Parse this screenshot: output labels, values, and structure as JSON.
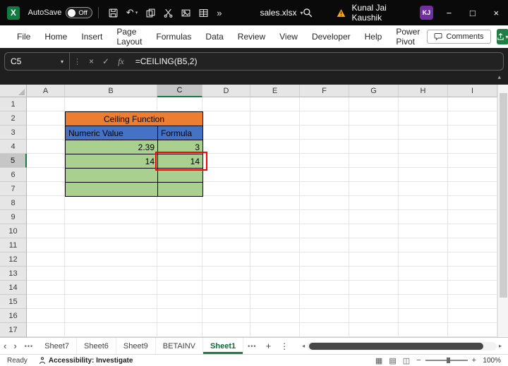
{
  "titlebar": {
    "logo_letter": "X",
    "autosave_label": "AutoSave",
    "autosave_state": "Off",
    "filename": "sales.xlsx",
    "user_name": "Kunal Jai Kaushik",
    "user_initials": "KJ"
  },
  "ribbon": {
    "tabs": [
      "File",
      "Home",
      "Insert",
      "Page Layout",
      "Formulas",
      "Data",
      "Review",
      "View",
      "Developer",
      "Help",
      "Power Pivot"
    ],
    "comments_label": "Comments"
  },
  "formula_bar": {
    "name_box": "C5",
    "formula": "=CEILING(B5,2)",
    "fx_label": "fx"
  },
  "grid": {
    "columns": [
      "A",
      "B",
      "C",
      "D",
      "E",
      "F",
      "G",
      "H",
      "I"
    ],
    "rows": [
      "1",
      "2",
      "3",
      "4",
      "5",
      "6",
      "7",
      "8",
      "9",
      "10",
      "11",
      "12",
      "13",
      "14",
      "15",
      "16",
      "17"
    ],
    "selected": {
      "column": "C",
      "row": "5",
      "cell": "C5"
    },
    "table": {
      "title": "Ceiling Function",
      "headers": [
        "Numeric Value",
        "Formula"
      ],
      "rows": [
        [
          "2.39",
          "3"
        ],
        [
          "14",
          "14"
        ],
        [
          "",
          ""
        ],
        [
          "",
          ""
        ]
      ]
    }
  },
  "sheet_tabs": {
    "items": [
      "Sheet7",
      "Sheet6",
      "Sheet9",
      "BETAINV"
    ],
    "active": "Sheet1"
  },
  "status_bar": {
    "ready_label": "Ready",
    "accessibility_label": "Accessibility: Investigate",
    "zoom_level": "100%"
  },
  "icons": {
    "minimize": "−",
    "maximize": "□",
    "close": "×",
    "caret_down": "▾",
    "more_chevrons": "»",
    "undo": "↶",
    "grip": "⋮",
    "cancel": "×",
    "enter": "✓",
    "collapse": "▴",
    "tab_prev": "‹",
    "tab_next": "›",
    "dots": "•••",
    "plus": "+",
    "kebab": "⋮",
    "scroll_left": "◂",
    "scroll_right": "▸",
    "view_normal": "▦",
    "view_layout": "▤",
    "view_break": "◫",
    "zoom_out": "−",
    "zoom_in": "+"
  },
  "colors": {
    "accent_green": "#107C41",
    "table_orange": "#ED7D31",
    "table_blue": "#4472C4",
    "table_green": "#A9D08E",
    "annotation_red": "#FF0000",
    "avatar_purple": "#7030A0",
    "titlebar_black": "#0A0A0A"
  }
}
